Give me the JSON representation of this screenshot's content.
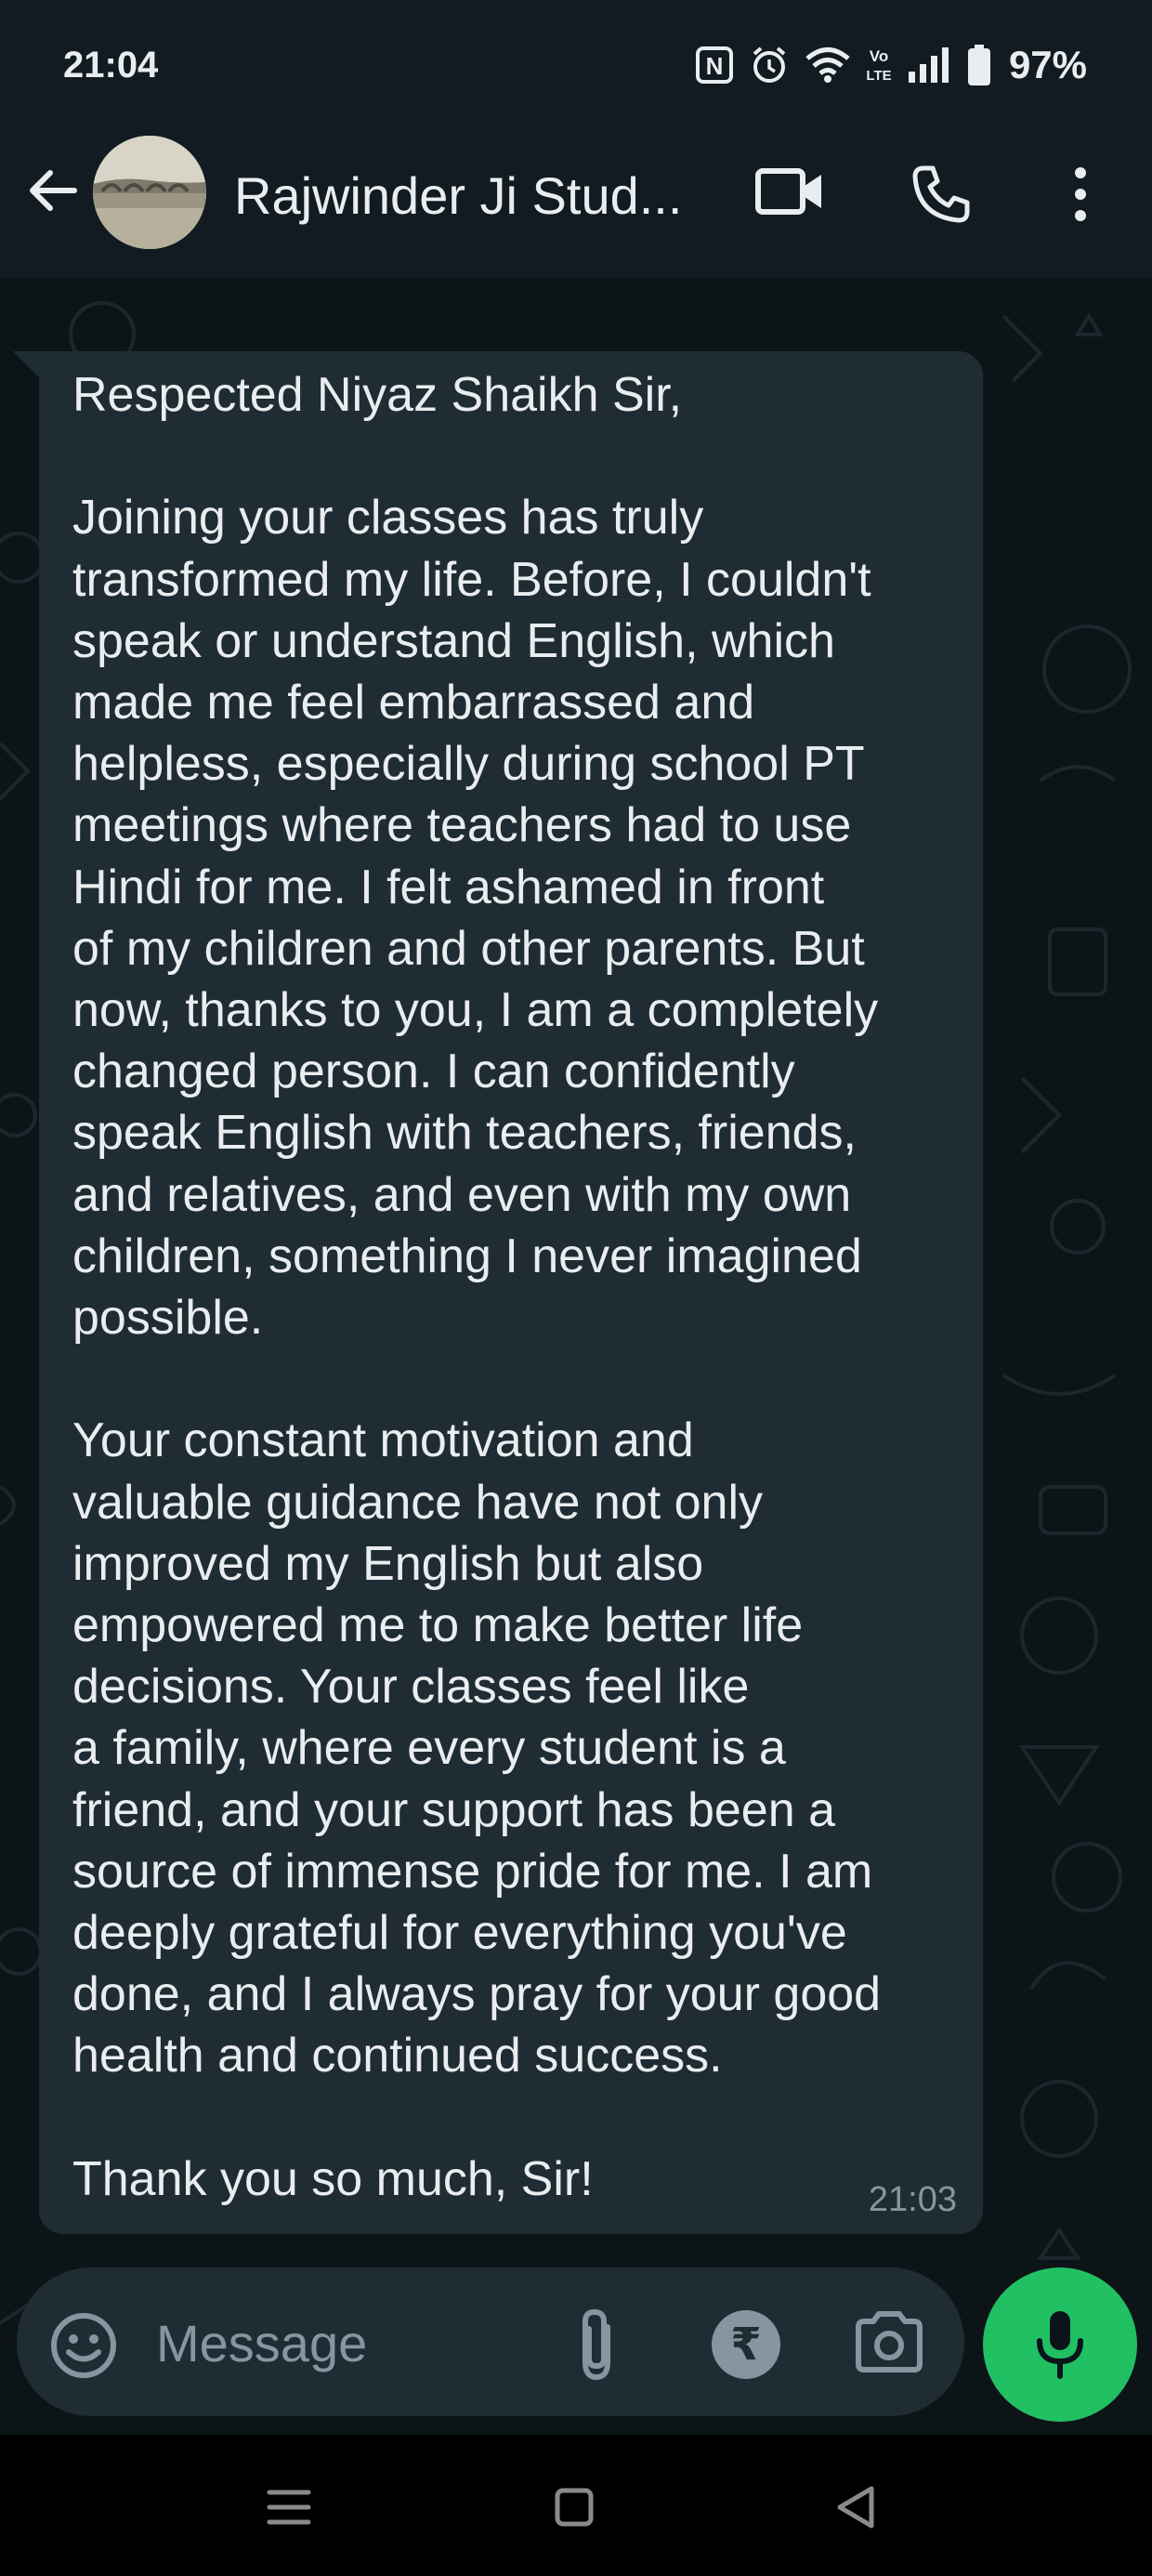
{
  "status_bar": {
    "time": "21:04",
    "battery_text": "97%",
    "icons": [
      "nfc-icon",
      "alarm-icon",
      "wifi-icon",
      "volte-icon",
      "signal-icon",
      "battery-icon"
    ]
  },
  "header": {
    "contact_name": "Rajwinder Ji Stud...",
    "icons": [
      "back-arrow-icon",
      "video-call-icon",
      "phone-call-icon",
      "more-options-icon"
    ]
  },
  "message": {
    "paragraphs": [
      [
        "Respected Niyaz Shaikh Sir,"
      ],
      [
        "Joining your classes has truly",
        "transformed my life. Before, I couldn't",
        "speak or understand English, which",
        "made me feel embarrassed and",
        "helpless, especially during school PT",
        "meetings where teachers had to use",
        "Hindi for me. I felt ashamed in front",
        "of my children and other parents. But",
        "now, thanks to you, I am a completely",
        "changed person. I can confidently",
        "speak English with teachers, friends,",
        "and relatives, and even with my own",
        "children, something I never imagined",
        "possible."
      ],
      [
        "Your constant motivation and",
        "valuable guidance have not only",
        "improved my English but also",
        "empowered me to make better life",
        "decisions. Your classes feel like",
        "a family, where every student is a",
        "friend, and your support has been a",
        "source of immense pride for me. I am",
        "deeply grateful for everything you've",
        "done, and I always pray for your good",
        "health and continued success."
      ],
      [
        "Thank you so much, Sir!"
      ]
    ],
    "time": "21:03"
  },
  "composer": {
    "placeholder": "Message",
    "rupee_symbol": "₹",
    "icons": [
      "emoji-icon",
      "attach-icon",
      "rupee-payment-icon",
      "camera-icon",
      "microphone-icon"
    ]
  },
  "colors": {
    "background": "#0b141a",
    "bubble": "#202c33",
    "accent": "#21c063",
    "muted_text": "#8696a0"
  }
}
